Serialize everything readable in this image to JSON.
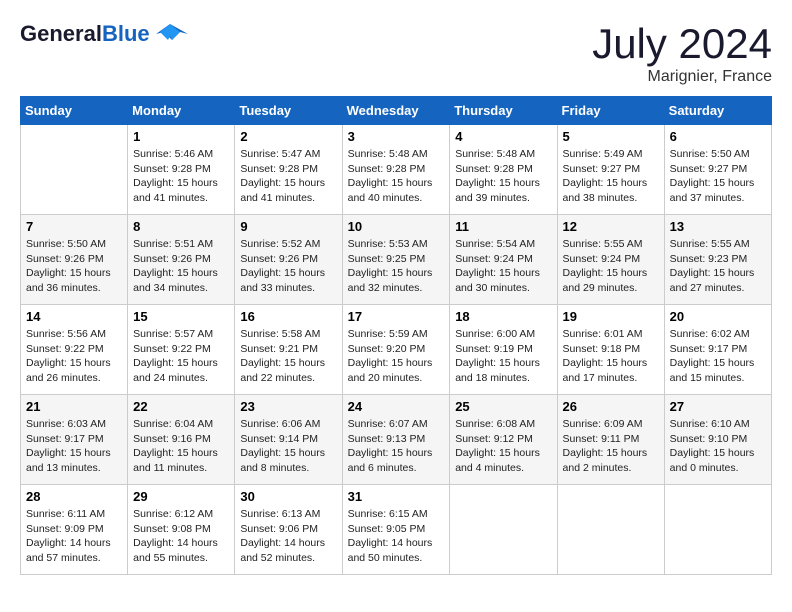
{
  "header": {
    "logo_line1": "General",
    "logo_line2": "Blue",
    "month": "July 2024",
    "location": "Marignier, France"
  },
  "days_of_week": [
    "Sunday",
    "Monday",
    "Tuesday",
    "Wednesday",
    "Thursday",
    "Friday",
    "Saturday"
  ],
  "weeks": [
    [
      {
        "day": "",
        "sunrise": "",
        "sunset": "",
        "daylight": ""
      },
      {
        "day": "1",
        "sunrise": "5:46 AM",
        "sunset": "9:28 PM",
        "daylight": "15 hours and 41 minutes."
      },
      {
        "day": "2",
        "sunrise": "5:47 AM",
        "sunset": "9:28 PM",
        "daylight": "15 hours and 41 minutes."
      },
      {
        "day": "3",
        "sunrise": "5:48 AM",
        "sunset": "9:28 PM",
        "daylight": "15 hours and 40 minutes."
      },
      {
        "day": "4",
        "sunrise": "5:48 AM",
        "sunset": "9:28 PM",
        "daylight": "15 hours and 39 minutes."
      },
      {
        "day": "5",
        "sunrise": "5:49 AM",
        "sunset": "9:27 PM",
        "daylight": "15 hours and 38 minutes."
      },
      {
        "day": "6",
        "sunrise": "5:50 AM",
        "sunset": "9:27 PM",
        "daylight": "15 hours and 37 minutes."
      }
    ],
    [
      {
        "day": "7",
        "sunrise": "5:50 AM",
        "sunset": "9:26 PM",
        "daylight": "15 hours and 36 minutes."
      },
      {
        "day": "8",
        "sunrise": "5:51 AM",
        "sunset": "9:26 PM",
        "daylight": "15 hours and 34 minutes."
      },
      {
        "day": "9",
        "sunrise": "5:52 AM",
        "sunset": "9:26 PM",
        "daylight": "15 hours and 33 minutes."
      },
      {
        "day": "10",
        "sunrise": "5:53 AM",
        "sunset": "9:25 PM",
        "daylight": "15 hours and 32 minutes."
      },
      {
        "day": "11",
        "sunrise": "5:54 AM",
        "sunset": "9:24 PM",
        "daylight": "15 hours and 30 minutes."
      },
      {
        "day": "12",
        "sunrise": "5:55 AM",
        "sunset": "9:24 PM",
        "daylight": "15 hours and 29 minutes."
      },
      {
        "day": "13",
        "sunrise": "5:55 AM",
        "sunset": "9:23 PM",
        "daylight": "15 hours and 27 minutes."
      }
    ],
    [
      {
        "day": "14",
        "sunrise": "5:56 AM",
        "sunset": "9:22 PM",
        "daylight": "15 hours and 26 minutes."
      },
      {
        "day": "15",
        "sunrise": "5:57 AM",
        "sunset": "9:22 PM",
        "daylight": "15 hours and 24 minutes."
      },
      {
        "day": "16",
        "sunrise": "5:58 AM",
        "sunset": "9:21 PM",
        "daylight": "15 hours and 22 minutes."
      },
      {
        "day": "17",
        "sunrise": "5:59 AM",
        "sunset": "9:20 PM",
        "daylight": "15 hours and 20 minutes."
      },
      {
        "day": "18",
        "sunrise": "6:00 AM",
        "sunset": "9:19 PM",
        "daylight": "15 hours and 18 minutes."
      },
      {
        "day": "19",
        "sunrise": "6:01 AM",
        "sunset": "9:18 PM",
        "daylight": "15 hours and 17 minutes."
      },
      {
        "day": "20",
        "sunrise": "6:02 AM",
        "sunset": "9:17 PM",
        "daylight": "15 hours and 15 minutes."
      }
    ],
    [
      {
        "day": "21",
        "sunrise": "6:03 AM",
        "sunset": "9:17 PM",
        "daylight": "15 hours and 13 minutes."
      },
      {
        "day": "22",
        "sunrise": "6:04 AM",
        "sunset": "9:16 PM",
        "daylight": "15 hours and 11 minutes."
      },
      {
        "day": "23",
        "sunrise": "6:06 AM",
        "sunset": "9:14 PM",
        "daylight": "15 hours and 8 minutes."
      },
      {
        "day": "24",
        "sunrise": "6:07 AM",
        "sunset": "9:13 PM",
        "daylight": "15 hours and 6 minutes."
      },
      {
        "day": "25",
        "sunrise": "6:08 AM",
        "sunset": "9:12 PM",
        "daylight": "15 hours and 4 minutes."
      },
      {
        "day": "26",
        "sunrise": "6:09 AM",
        "sunset": "9:11 PM",
        "daylight": "15 hours and 2 minutes."
      },
      {
        "day": "27",
        "sunrise": "6:10 AM",
        "sunset": "9:10 PM",
        "daylight": "15 hours and 0 minutes."
      }
    ],
    [
      {
        "day": "28",
        "sunrise": "6:11 AM",
        "sunset": "9:09 PM",
        "daylight": "14 hours and 57 minutes."
      },
      {
        "day": "29",
        "sunrise": "6:12 AM",
        "sunset": "9:08 PM",
        "daylight": "14 hours and 55 minutes."
      },
      {
        "day": "30",
        "sunrise": "6:13 AM",
        "sunset": "9:06 PM",
        "daylight": "14 hours and 52 minutes."
      },
      {
        "day": "31",
        "sunrise": "6:15 AM",
        "sunset": "9:05 PM",
        "daylight": "14 hours and 50 minutes."
      },
      {
        "day": "",
        "sunrise": "",
        "sunset": "",
        "daylight": ""
      },
      {
        "day": "",
        "sunrise": "",
        "sunset": "",
        "daylight": ""
      },
      {
        "day": "",
        "sunrise": "",
        "sunset": "",
        "daylight": ""
      }
    ]
  ]
}
